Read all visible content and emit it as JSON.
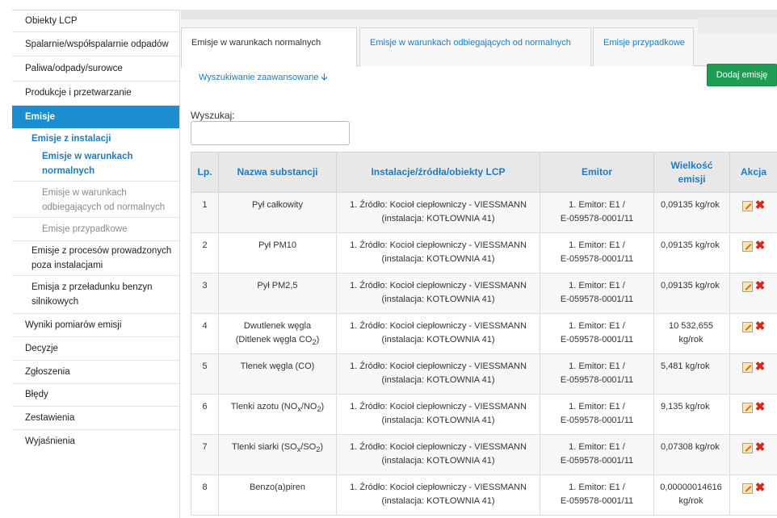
{
  "sidebar": {
    "items": [
      {
        "label": "Obiekty LCP"
      },
      {
        "label": "Spalarnie/współspalarnie odpadów"
      },
      {
        "label": "Paliwa/odpady/surowce"
      },
      {
        "label": "Produkcje i przetwarzanie"
      },
      {
        "label": "Emisje"
      },
      {
        "label": "Emisje z instalacji"
      },
      {
        "label": "Emisje w warunkach normalnych"
      },
      {
        "label": "Emisje w warunkach odbiegających od normalnych"
      },
      {
        "label": "Emisje przypadkowe"
      },
      {
        "label": "Emisje z procesów prowadzonych poza instalacjami"
      },
      {
        "label": "Emisja z przeładunku benzyn silnikowych"
      },
      {
        "label": "Wyniki pomiarów emisji"
      },
      {
        "label": "Decyzje"
      },
      {
        "label": "Zgłoszenia"
      },
      {
        "label": "Błędy"
      },
      {
        "label": "Zestawienia"
      },
      {
        "label": "Wyjaśnienia"
      }
    ]
  },
  "tabs": [
    {
      "label": "Emisje w warunkach normalnych"
    },
    {
      "label": "Emisje w warunkach odbiegających od normalnych"
    },
    {
      "label": "Emisje przypadkowe"
    }
  ],
  "toolbar": {
    "advanced_search": "Wyszukiwanie zaawansowane",
    "add_button": "Dodaj emisję"
  },
  "search": {
    "label": "Wyszukaj:",
    "value": ""
  },
  "table": {
    "headers": {
      "lp": "Lp.",
      "substance": "Nazwa substancji",
      "installation": "Instalacje/źródła/obiekty LCP",
      "emitter": "Emitor",
      "amount_line1": "Wielkość",
      "amount_line2": "emisji",
      "action": "Akcja"
    },
    "rows": [
      {
        "lp": "1",
        "substance": "Pył całkowity",
        "sub": "",
        "substance_post": "",
        "src1": "1. Źródło: Kocioł ciepłowniczy - VIESSMANN",
        "src2": "(instalacja: KOTŁOWNIA 41)",
        "em1": "1. Emitor: E1 /",
        "em2": "E-059578-0001/11",
        "amt1": "0,09135 kg/rok",
        "amt2": ""
      },
      {
        "lp": "2",
        "substance": "Pył PM10",
        "sub": "",
        "substance_post": "",
        "src1": "1. Źródło: Kocioł ciepłowniczy - VIESSMANN",
        "src2": "(instalacja: KOTŁOWNIA 41)",
        "em1": "1. Emitor: E1 /",
        "em2": "E-059578-0001/11",
        "amt1": "0,09135 kg/rok",
        "amt2": ""
      },
      {
        "lp": "3",
        "substance": "Pył PM2,5",
        "sub": "",
        "substance_post": "",
        "src1": "1. Źródło: Kocioł ciepłowniczy - VIESSMANN",
        "src2": "(instalacja: KOTŁOWNIA 41)",
        "em1": "1. Emitor: E1 /",
        "em2": "E-059578-0001/11",
        "amt1": "0,09135 kg/rok",
        "amt2": ""
      },
      {
        "lp": "4",
        "substance": "Dwutlenek węgla",
        "substance2": "(Ditlenek węgla CO",
        "sub": "2",
        "substance_post": ")",
        "src1": "1. Źródło: Kocioł ciepłowniczy - VIESSMANN",
        "src2": "(instalacja: KOTŁOWNIA 41)",
        "em1": "1. Emitor: E1 /",
        "em2": "E-059578-0001/11",
        "amt1": "10 532,655",
        "amt2": "kg/rok"
      },
      {
        "lp": "5",
        "substance": "Tlenek węgla (CO)",
        "sub": "",
        "substance_post": "",
        "src1": "1. Źródło: Kocioł ciepłowniczy - VIESSMANN",
        "src2": "(instalacja: KOTŁOWNIA 41)",
        "em1": "1. Emitor: E1 /",
        "em2": "E-059578-0001/11",
        "amt1": "5,481 kg/rok",
        "amt2": ""
      },
      {
        "lp": "6",
        "substance": "Tlenki azotu (NO",
        "sub": "x",
        "mid": "/NO",
        "sub2": "2",
        "substance_post": ")",
        "src1": "1. Źródło: Kocioł ciepłowniczy - VIESSMANN",
        "src2": "(instalacja: KOTŁOWNIA 41)",
        "em1": "1. Emitor: E1 /",
        "em2": "E-059578-0001/11",
        "amt1": "9,135 kg/rok",
        "amt2": ""
      },
      {
        "lp": "7",
        "substance": "Tlenki siarki (SO",
        "sub": "x",
        "mid": "/SO",
        "sub2": "2",
        "substance_post": ")",
        "src1": "1. Źródło: Kocioł ciepłowniczy - VIESSMANN",
        "src2": "(instalacja: KOTŁOWNIA 41)",
        "em1": "1. Emitor: E1 /",
        "em2": "E-059578-0001/11",
        "amt1": "0,07308 kg/rok",
        "amt2": ""
      },
      {
        "lp": "8",
        "substance": "Benzo(a)piren",
        "sub": "",
        "substance_post": "",
        "src1": "1. Źródło: Kocioł ciepłowniczy - VIESSMANN",
        "src2": "(instalacja: KOTŁOWNIA 41)",
        "em1": "1. Emitor: E1 /",
        "em2": "E-059578-0001/11",
        "amt1": "0,00000014616",
        "amt2": "kg/rok"
      }
    ]
  },
  "icons": {
    "edit": "edit-icon",
    "delete": "delete-icon"
  },
  "colors": {
    "accent": "#1c8ed0",
    "add_button": "#1f9d55",
    "delete": "#d62a1e"
  }
}
